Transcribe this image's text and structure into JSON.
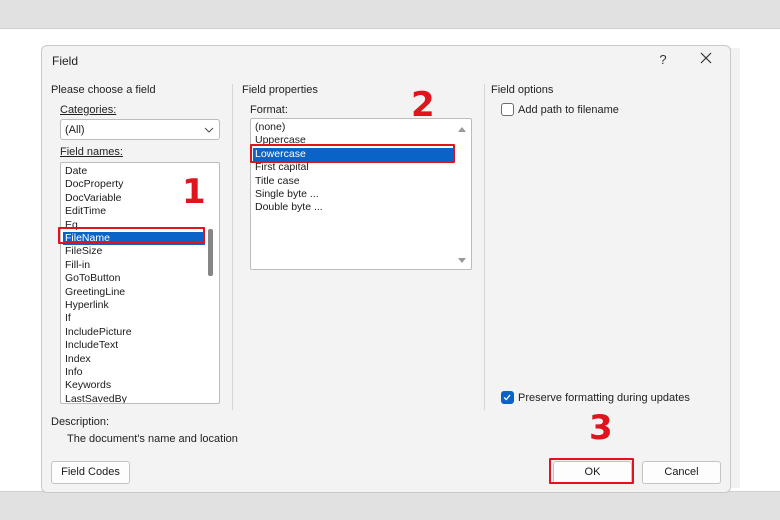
{
  "dialog": {
    "title": "Field",
    "help_label": "?",
    "close_icon": "close-icon"
  },
  "left_panel": {
    "heading": "Please choose a field",
    "categories_label": "Categories:",
    "categories_value": "(All)",
    "field_names_label": "Field names:",
    "field_names": [
      "Date",
      "DocProperty",
      "DocVariable",
      "EditTime",
      "Eq",
      "FileName",
      "FileSize",
      "Fill-in",
      "GoToButton",
      "GreetingLine",
      "Hyperlink",
      "If",
      "IncludePicture",
      "IncludeText",
      "Index",
      "Info",
      "Keywords",
      "LastSavedBy"
    ],
    "selected_field": "FileName"
  },
  "middle_panel": {
    "heading": "Field properties",
    "format_label": "Format:",
    "formats": [
      "(none)",
      "Uppercase",
      "Lowercase",
      "First capital",
      "Title case",
      "Single byte ...",
      "Double byte ..."
    ],
    "selected_format": "Lowercase"
  },
  "right_panel": {
    "heading": "Field options",
    "add_path_label": "Add path to filename",
    "add_path_checked": false,
    "preserve_label": "Preserve formatting during updates",
    "preserve_checked": true
  },
  "description": {
    "label": "Description:",
    "text": "The document's name and location"
  },
  "buttons": {
    "field_codes": "Field Codes",
    "ok": "OK",
    "cancel": "Cancel"
  },
  "annotations": {
    "step1": "1",
    "step2": "2",
    "step3": "3",
    "color": "#e0141c"
  },
  "colors": {
    "selection": "#0a64c8",
    "dialog_bg": "#f3f3f3"
  }
}
